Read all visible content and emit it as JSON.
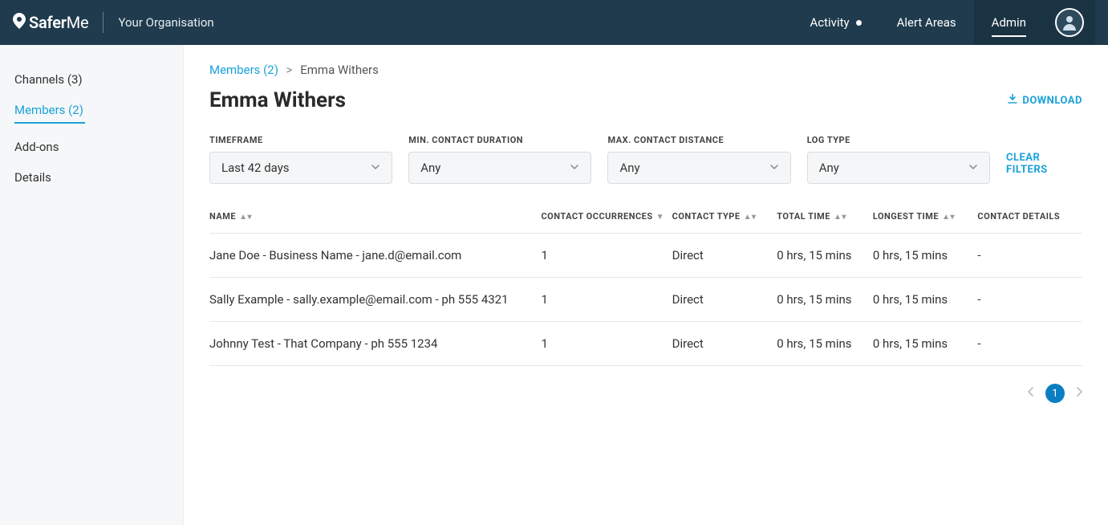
{
  "header": {
    "brand_prefix": "Safer",
    "brand_suffix": "Me",
    "organisation": "Your Organisation",
    "nav": {
      "activity": "Activity",
      "alert_areas": "Alert Areas",
      "admin": "Admin"
    }
  },
  "sidebar": {
    "channels": "Channels (3)",
    "members": "Members (2)",
    "addons": "Add-ons",
    "details": "Details"
  },
  "breadcrumb": {
    "parent": "Members (2)",
    "separator": ">",
    "current": "Emma Withers"
  },
  "page_title": "Emma Withers",
  "download_label": "DOWNLOAD",
  "filters": {
    "timeframe": {
      "label": "TIMEFRAME",
      "value": "Last 42 days"
    },
    "min_duration": {
      "label": "MIN. CONTACT DURATION",
      "value": "Any"
    },
    "max_distance": {
      "label": "MAX. CONTACT DISTANCE",
      "value": "Any"
    },
    "log_type": {
      "label": "LOG TYPE",
      "value": "Any"
    },
    "clear": "CLEAR FILTERS"
  },
  "table": {
    "headers": {
      "name": "NAME",
      "occurrences": "CONTACT OCCURRENCES",
      "type": "CONTACT TYPE",
      "total": "TOTAL TIME",
      "longest": "LONGEST TIME",
      "details": "CONTACT DETAILS"
    },
    "rows": [
      {
        "name": "Jane Doe - Business Name - jane.d@email.com",
        "occurrences": "1",
        "type": "Direct",
        "total": "0 hrs, 15 mins",
        "longest": "0 hrs, 15 mins",
        "details": "-"
      },
      {
        "name": "Sally Example - sally.example@email.com - ph 555 4321",
        "occurrences": "1",
        "type": "Direct",
        "total": "0 hrs, 15 mins",
        "longest": "0 hrs, 15 mins",
        "details": "-"
      },
      {
        "name": "Johnny Test - That Company - ph 555 1234",
        "occurrences": "1",
        "type": "Direct",
        "total": "0 hrs, 15 mins",
        "longest": "0 hrs, 15 mins",
        "details": "-"
      }
    ]
  },
  "pagination": {
    "current": "1"
  }
}
